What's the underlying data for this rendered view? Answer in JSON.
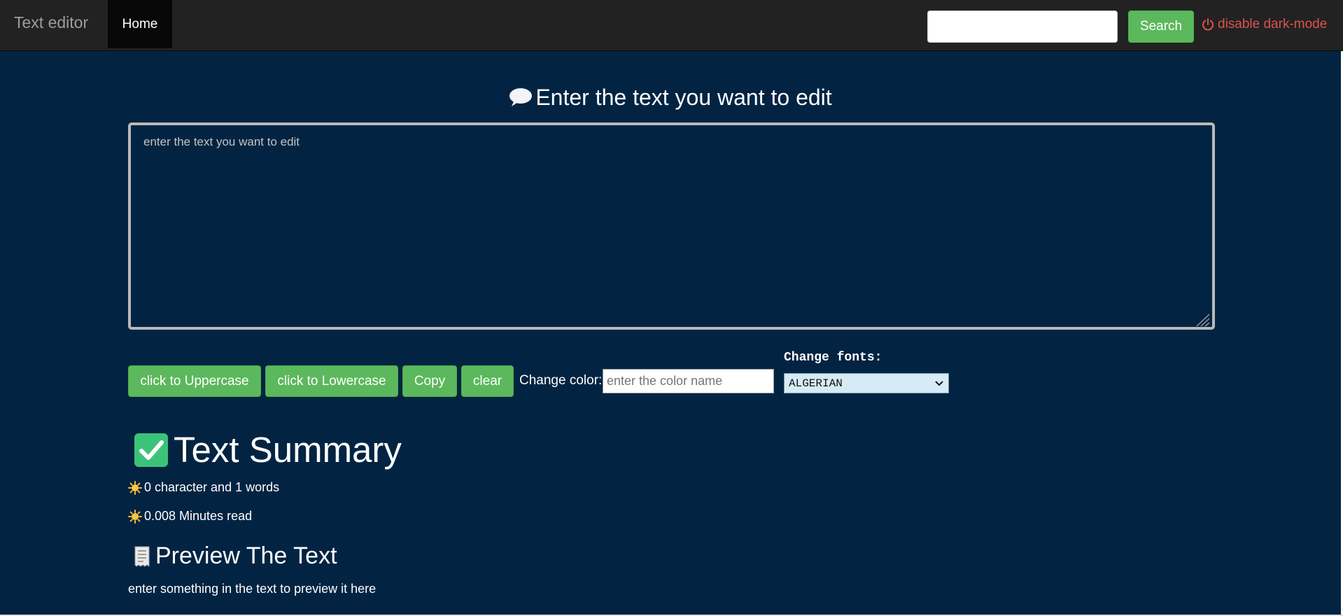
{
  "navbar": {
    "brand": "Text editor",
    "home_label": "Home",
    "search_placeholder": "",
    "search_label": "Search",
    "darkmode_label": "disable dark-mode"
  },
  "editor": {
    "heading": "Enter the text you want to edit",
    "textarea_value": "",
    "textarea_placeholder": "enter the text you want to edit"
  },
  "toolbar": {
    "uppercase_label": "click to Uppercase",
    "lowercase_label": "click to Lowercase",
    "copy_label": "Copy",
    "clear_label": "clear",
    "change_color_label": "Change color:",
    "color_placeholder": "enter the color name",
    "change_fonts_label": "Change fonts:",
    "font_selected": "ALGERIAN"
  },
  "summary": {
    "heading": "Text Summary",
    "char_words": "0 character and 1 words",
    "minutes_read": "0.008 Minutes read"
  },
  "preview": {
    "heading": "Preview The Text",
    "text": "enter something in the text to preview it here"
  },
  "icons": {
    "speech": "speech-bubble-icon",
    "power": "power-icon",
    "check": "check-box-icon",
    "sun": "sun-icon",
    "receipt": "receipt-icon",
    "chevron": "chevron-down-icon"
  },
  "colors": {
    "navbar_bg": "#222222",
    "main_bg": "#022442",
    "accent_green": "#5cb85c",
    "danger_red": "#d9534f",
    "check_green": "#3cc37a",
    "font_select_bg": "#d6ebf5"
  }
}
